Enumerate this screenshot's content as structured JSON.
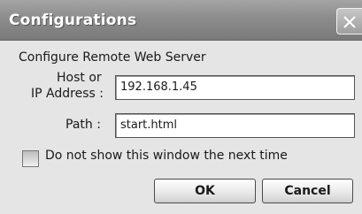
{
  "window": {
    "title": "Configurations",
    "close_icon": "close-icon"
  },
  "section_heading": "Configure Remote Web Server",
  "host": {
    "label_line1": "Host or",
    "label_line2": "IP Address :",
    "value": "192.168.1.45"
  },
  "path": {
    "label": "Path :",
    "value": "start.html"
  },
  "do_not_show": {
    "label": "Do not show this window the next time",
    "checked": false
  },
  "buttons": {
    "ok": "OK",
    "cancel": "Cancel"
  }
}
